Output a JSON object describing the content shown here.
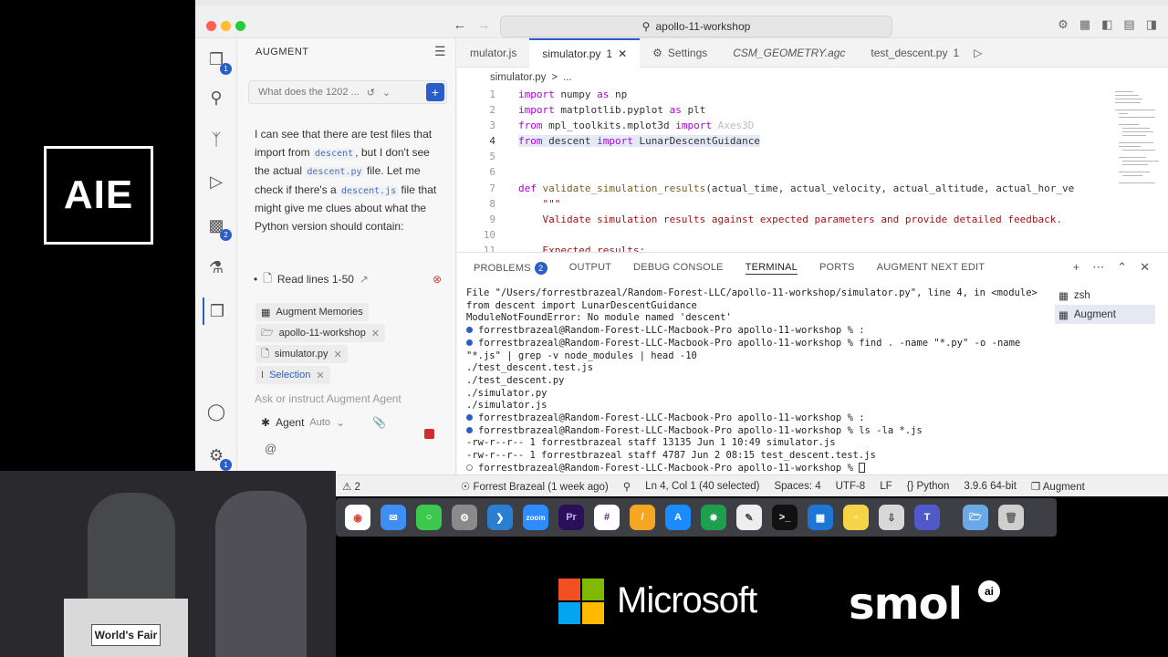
{
  "logo": {
    "text": "AIE"
  },
  "titlebar": {
    "search": "apollo-11-workshop"
  },
  "activity": {
    "explorer_badge": "1",
    "extensions_badge": "2",
    "settings_badge": "1"
  },
  "augment": {
    "panel_title": "AUGMENT",
    "thread_title": "What does the 1202 ...",
    "message": {
      "p1": "I can see that there are test files that import from ",
      "c1": "descent",
      "p2": ", but I don't see the actual ",
      "c2": "descent.py",
      "p3": " file. Let me check if there's a ",
      "c3": "descent.js",
      "p4": " file that might give me clues about what the Python version should contain:"
    },
    "tool_call": "Read lines 1-50",
    "context": [
      {
        "label": "Augment Memories"
      },
      {
        "label": "apollo-11-workshop"
      },
      {
        "label": "simulator.py"
      },
      {
        "label": "Selection"
      }
    ],
    "input_placeholder": "Ask or instruct Augment Agent",
    "mode": "Agent",
    "mode_option": "Auto",
    "at_symbol": "@"
  },
  "tabs": [
    {
      "label": "mulator.js"
    },
    {
      "label": "simulator.py",
      "modified": "1"
    },
    {
      "label": "Settings"
    },
    {
      "label": "CSM_GEOMETRY.agc"
    },
    {
      "label": "test_descent.py",
      "modified": "1"
    }
  ],
  "breadcrumb": {
    "file": "simulator.py",
    "sep": ">",
    "rest": "..."
  },
  "code": {
    "lines": [
      "1",
      "2",
      "3",
      "4",
      "5",
      "6",
      "7",
      "8",
      "9",
      "10",
      "11"
    ],
    "l1a": "import",
    "l1b": " numpy ",
    "l1c": "as",
    "l1d": " np",
    "l2a": "import",
    "l2b": " matplotlib.pyplot ",
    "l2c": "as",
    "l2d": " plt",
    "l3a": "from",
    "l3b": " mpl_toolkits.mplot3d ",
    "l3c": "import",
    "l3d": " Axes3D",
    "l4a": "from",
    "l4b": " descent ",
    "l4c": "import",
    "l4d": " LunarDescentGuidance",
    "l7a": "def",
    "l7b": " validate_simulation_results",
    "l7c": "(actual_time, actual_velocity, actual_altitude, actual_hor_ve",
    "l8": "    \"\"\"",
    "l9": "    Validate simulation results against expected parameters and provide detailed feedback.",
    "l11": "    Expected results:"
  },
  "panel": {
    "tabs": [
      "PROBLEMS",
      "OUTPUT",
      "DEBUG CONSOLE",
      "TERMINAL",
      "PORTS",
      "AUGMENT NEXT EDIT"
    ],
    "problems_count": "2",
    "terminal": [
      "  File \"/Users/forrestbrazeal/Random-Forest-LLC/apollo-11-workshop/simulator.py\", line 4, in <module>",
      "    from descent import LunarDescentGuidance",
      "ModuleNotFoundError: No module named 'descent'",
      "forrestbrazeal@Random-Forest-LLC-Macbook-Pro apollo-11-workshop % :",
      "forrestbrazeal@Random-Forest-LLC-Macbook-Pro apollo-11-workshop % find . -name \"*.py\" -o -name",
      " \"*.js\" | grep -v node_modules | head -10",
      "./test_descent.test.js",
      "./test_descent.py",
      "./simulator.py",
      "./simulator.js",
      "forrestbrazeal@Random-Forest-LLC-Macbook-Pro apollo-11-workshop % :",
      "forrestbrazeal@Random-Forest-LLC-Macbook-Pro apollo-11-workshop % ls -la *.js",
      "-rw-r--r--   1 forrestbrazeal  staff  13135 Jun  1 10:49 simulator.js",
      "-rw-r--r--   1 forrestbrazeal  staff   4787 Jun  2 08:15 test_descent.test.js",
      "forrestbrazeal@Random-Forest-LLC-Macbook-Pro apollo-11-workshop % "
    ],
    "terminals": [
      "zsh",
      "Augment"
    ]
  },
  "statusbar": {
    "errors": "2",
    "blame": "Forrest Brazeal (1 week ago)",
    "position": "Ln 4, Col 1 (40 selected)",
    "spaces": "Spaces: 4",
    "encoding": "UTF-8",
    "eol": "LF",
    "language": "Python",
    "interpreter": "3.9.6 64-bit",
    "augment": "Augment"
  },
  "dock_apps": [
    "Chrome",
    "Mail",
    "Messages",
    "Settings",
    "VS Code",
    "Zoom",
    "Premiere",
    "Slack",
    "Notes",
    "App Store",
    "Git",
    "TextEdit",
    "Terminal",
    "Keynote",
    "Stickies",
    "Finder",
    "Teams",
    "Folder",
    "Trash"
  ],
  "video": {
    "podium_sign": "World's Fair"
  },
  "sponsors": {
    "microsoft": "Microsoft",
    "smol": "smol",
    "smol_ai": "ai"
  },
  "colors": {
    "accent": "#2a5fc9",
    "ms_red": "#f25022",
    "ms_green": "#7fba00",
    "ms_blue": "#00a4ef",
    "ms_yellow": "#ffb900"
  }
}
